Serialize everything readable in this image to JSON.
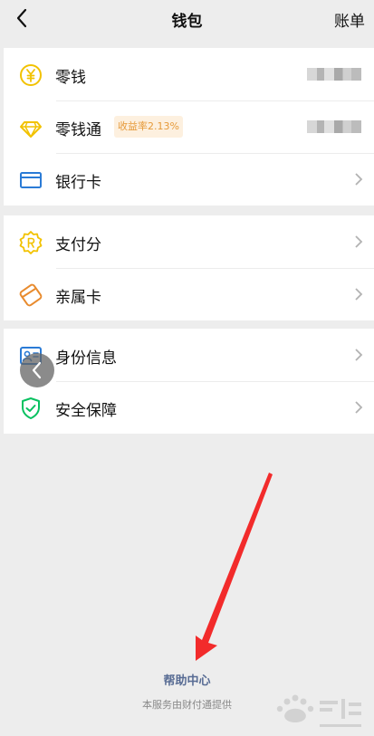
{
  "header": {
    "title": "钱包",
    "bill_label": "账单"
  },
  "group1": {
    "items": [
      {
        "label": "零钱",
        "icon": "yuan-coin-icon"
      },
      {
        "label": "零钱通",
        "icon": "diamond-icon",
        "badge": "收益率2.13%"
      },
      {
        "label": "银行卡",
        "icon": "bank-card-icon"
      }
    ]
  },
  "group2": {
    "items": [
      {
        "label": "支付分",
        "icon": "credit-score-icon"
      },
      {
        "label": "亲属卡",
        "icon": "family-card-icon"
      }
    ]
  },
  "group3": {
    "items": [
      {
        "label": "身份信息",
        "icon": "id-card-icon"
      },
      {
        "label": "安全保障",
        "icon": "shield-icon"
      }
    ]
  },
  "footer": {
    "help_center": "帮助中心",
    "provider": "本服务由财付通提供"
  },
  "colors": {
    "accent_yellow": "#f2c200",
    "accent_blue": "#2a7bd6",
    "accent_green": "#07c160",
    "accent_orange": "#e88b2e",
    "arrow_red": "#f22b2b",
    "help_link": "#586c94"
  }
}
